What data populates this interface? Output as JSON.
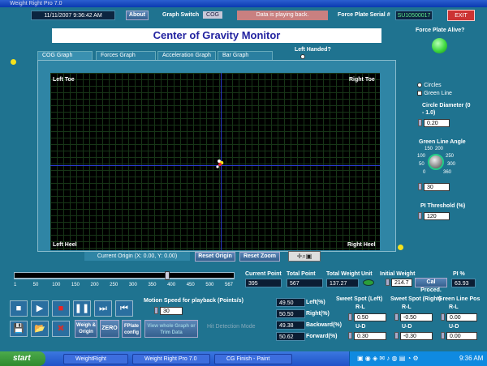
{
  "window": {
    "title": "Weight Right Pro 7.0"
  },
  "header": {
    "datetime": "11/11/2007 9:36:42 AM",
    "about_label": "About",
    "graph_switch_label": "Graph Switch",
    "graph_switch_value": "COG",
    "status_text": "Data is playing back.",
    "serial_label": "Force Plate Serial #",
    "serial_value": "SU10500017",
    "exit_label": "EXIT"
  },
  "main": {
    "title": "Center of Gravity Monitor",
    "alive_label": "Force Plate Alive?",
    "left_handed_label": "Left Handed?",
    "tabs": [
      {
        "label": "COG Graph"
      },
      {
        "label": "Forces Graph"
      },
      {
        "label": "Acceleration Graph"
      },
      {
        "label": "Bar Graph"
      }
    ],
    "corners": {
      "tl": "Left Toe",
      "tr": "Right Toe",
      "bl": "Left Heel",
      "br": "Right Heel"
    },
    "origin_text": "Current Origin (X: 0.00, Y: 0.00)",
    "reset_origin": "Reset  Origin",
    "reset_zoom": "Reset Zoom"
  },
  "right_panel": {
    "display_options": [
      "Circles",
      "Green Line"
    ],
    "circle_diameter_label": "Circle Diameter (0 - 1.0)",
    "circle_diameter_value": "0.20",
    "green_line_angle_label": "Green Line Angle",
    "knob_ticks": [
      "150",
      "200",
      "100",
      "250",
      "50",
      "300",
      "0",
      "360"
    ],
    "angle_value": "30",
    "pi_threshold_label": "PI Threshold (%)",
    "pi_threshold_value": "120"
  },
  "slider": {
    "ticks": [
      "1",
      "50",
      "100",
      "150",
      "200",
      "250",
      "300",
      "350",
      "400",
      "450",
      "500",
      "567"
    ],
    "position": 0.7
  },
  "stats": {
    "current_point_label": "Current Point",
    "current_point_value": "395",
    "total_point_label": "Total Point",
    "total_point_value": "567",
    "total_weight_label": "Total Weight",
    "total_weight_value": "137.27",
    "unit_label": "Unit",
    "initial_weight_label": "Initial Weight",
    "initial_weight_value": "214.7",
    "cal_proced": "Cal Proced.",
    "pi_label": "PI %",
    "pi_value": "63.93"
  },
  "playback": {
    "speed_label": "Motion Speed for playback (Points/s)",
    "speed_value": "30",
    "weigh_origin": "Weigh & Origin",
    "zero": "ZERO",
    "fplate_config": "FPlate config",
    "view_whole": "View whole Graph or Trim Data",
    "hit_detection": "Hit Detection Mode"
  },
  "percents": [
    {
      "value": "49.50",
      "label": "Left(%)"
    },
    {
      "value": "50.50",
      "label": "Right(%)"
    },
    {
      "value": "49.38",
      "label": "Backward(%)"
    },
    {
      "value": "50.62",
      "label": "Forward(%)"
    }
  ],
  "sweet_spot_left": {
    "title": "Sweet Spot (Left)",
    "rl_label": "R-L",
    "rl": "0.50",
    "ud_label": "U-D",
    "ud": "0.30"
  },
  "sweet_spot_right": {
    "title": "Sweet Spot (Right)",
    "rl_label": "R-L",
    "rl": "-0.50",
    "ud_label": "U-D",
    "ud": "-0.30"
  },
  "green_line_pos": {
    "title": "Green Line Pos",
    "rl_label": "R-L",
    "rl": "0.00",
    "ud_label": "U-D",
    "ud": "0.00"
  },
  "taskbar": {
    "start": "start",
    "items": [
      "WeightRight",
      "Weight Right Pro 7.0",
      "CG Finish - Paint"
    ],
    "clock": "9:36 AM"
  },
  "colors": {
    "led_alive": "#3ed83e",
    "led_indicator": "#f5e21c",
    "plot_bg": "#000000",
    "axis": "#2a3ad0"
  }
}
